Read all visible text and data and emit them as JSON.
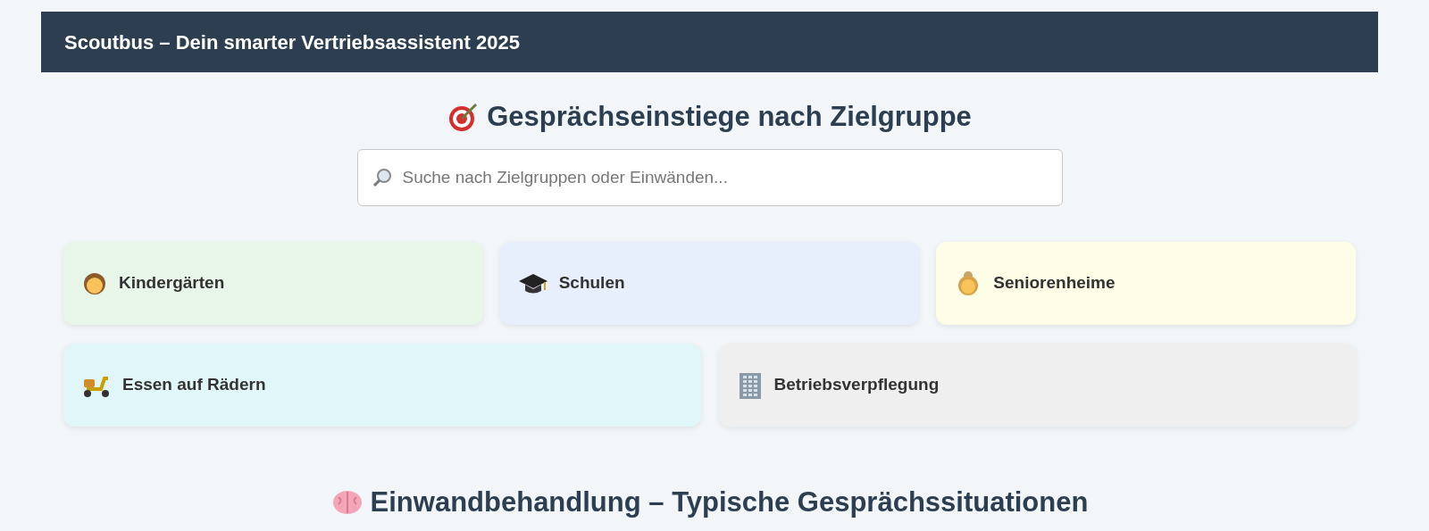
{
  "header": {
    "title": "Scoutbus – Dein smarter Vertriebsassistent 2025"
  },
  "section": {
    "title": "Gesprächseinstiege nach Zielgruppe"
  },
  "search": {
    "placeholder": "Suche nach Zielgruppen oder Einwänden..."
  },
  "target_groups": [
    {
      "label": "Kindergärten",
      "color": "#e8f5e9"
    },
    {
      "label": "Schulen",
      "color": "#e8effc"
    },
    {
      "label": "Seniorenheime",
      "color": "#fefde8"
    },
    {
      "label": "Essen auf Rädern",
      "color": "#e0f6f8"
    },
    {
      "label": "Betriebsverpflegung",
      "color": "#efefef"
    }
  ],
  "next_section": {
    "title": "Einwandbehandlung – Typische Gesprächssituationen"
  }
}
